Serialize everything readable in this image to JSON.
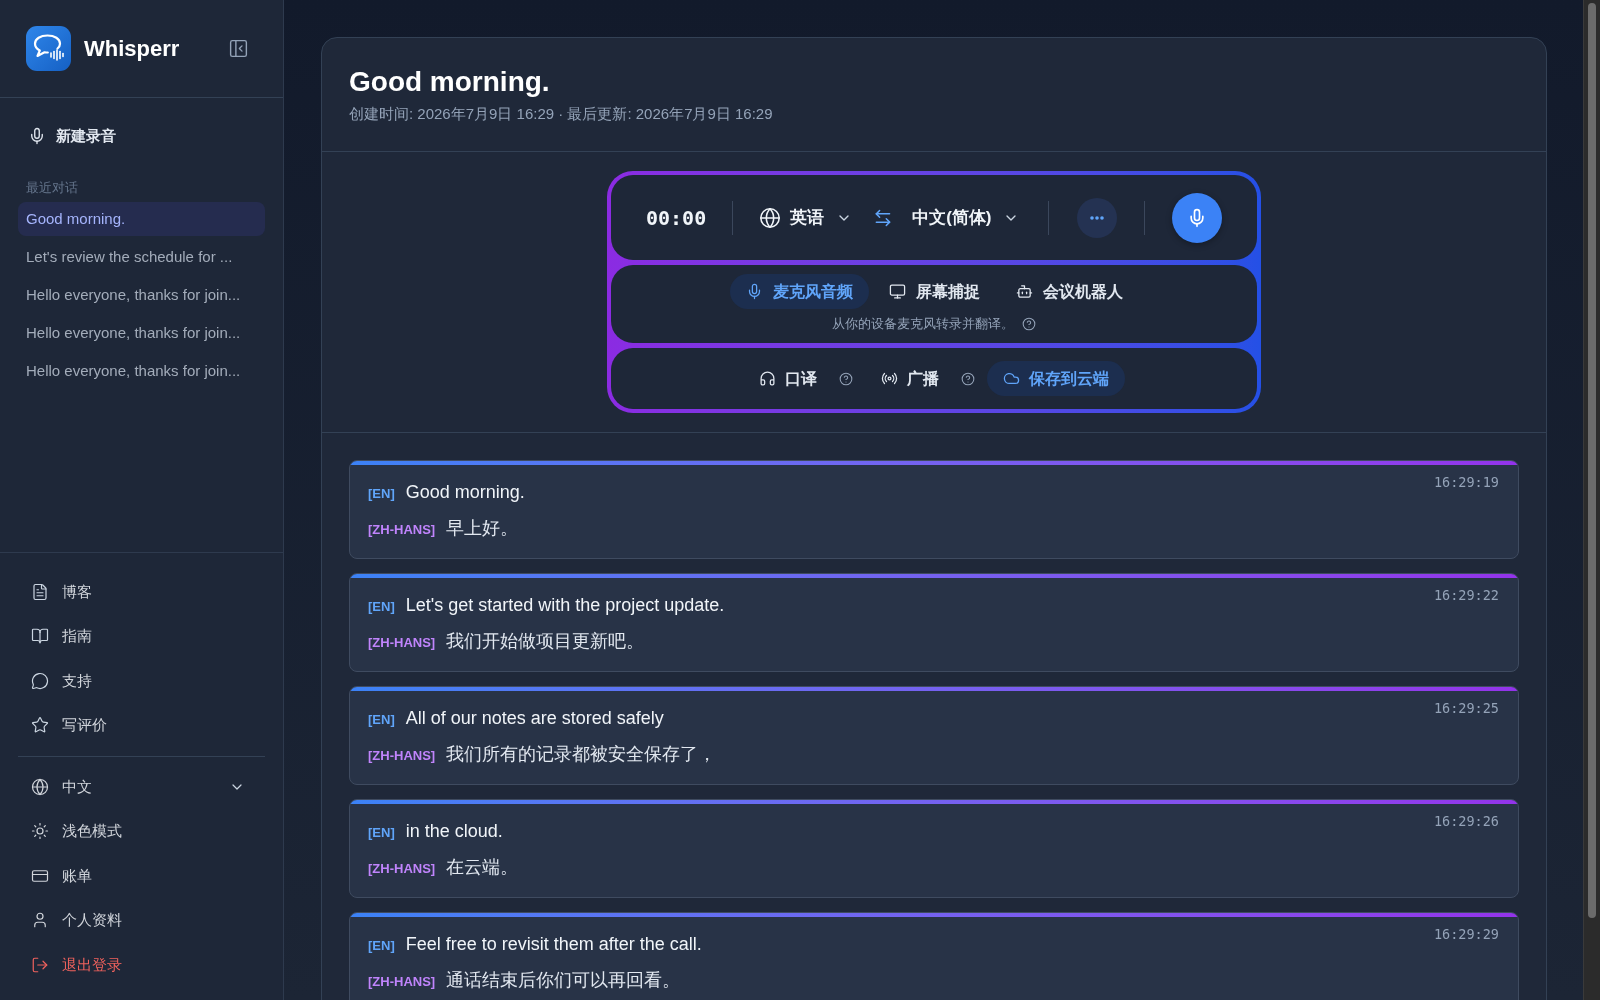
{
  "sidebar": {
    "app_name": "Whisperr",
    "new_recording": "新建录音",
    "recent_label": "最近对话",
    "recent": [
      {
        "title": "Good morning.",
        "selected": true
      },
      {
        "title": "Let's review the schedule for ...",
        "selected": false
      },
      {
        "title": "Hello everyone, thanks for join...",
        "selected": false
      },
      {
        "title": "Hello everyone, thanks for join...",
        "selected": false
      },
      {
        "title": "Hello everyone, thanks for join...",
        "selected": false
      }
    ],
    "links": [
      {
        "label": "博客"
      },
      {
        "label": "指南"
      },
      {
        "label": "支持"
      },
      {
        "label": "写评价"
      }
    ],
    "settings": [
      {
        "label": "中文",
        "kind": "dropdown"
      },
      {
        "label": "浅色模式",
        "kind": "link"
      },
      {
        "label": "账单",
        "kind": "link"
      },
      {
        "label": "个人资料",
        "kind": "link"
      },
      {
        "label": "退出登录",
        "kind": "danger"
      }
    ]
  },
  "conversation": {
    "title": "Good morning.",
    "meta": "创建时间: 2026年7月9日 16:29 · 最后更新: 2026年7月9日 16:29"
  },
  "recorder": {
    "timer": "00:00",
    "source_language": "英语",
    "target_language": "中文(简体)",
    "sources": [
      {
        "label": "麦克风音频",
        "selected": true
      },
      {
        "label": "屏幕捕捉",
        "selected": false
      },
      {
        "label": "会议机器人",
        "selected": false
      }
    ],
    "source_hint": "从你的设备麦克风转录并翻译。",
    "options": [
      {
        "label": "口译",
        "on": false,
        "help": true
      },
      {
        "label": "广播",
        "on": false,
        "help": true
      },
      {
        "label": "保存到云端",
        "on": true,
        "help": false
      }
    ]
  },
  "transcript": [
    {
      "time": "16:29:19",
      "lines": [
        {
          "kind": "original",
          "tag": "[EN]",
          "text": "Good morning."
        },
        {
          "kind": "translation",
          "tag": "[ZH-HANS]",
          "text": "早上好。"
        }
      ]
    },
    {
      "time": "16:29:22",
      "lines": [
        {
          "kind": "original",
          "tag": "[EN]",
          "text": "Let's get started with the project update."
        },
        {
          "kind": "translation",
          "tag": "[ZH-HANS]",
          "text": "我们开始做项目更新吧。"
        }
      ]
    },
    {
      "time": "16:29:25",
      "lines": [
        {
          "kind": "original",
          "tag": "[EN]",
          "text": "All of our notes are stored safely"
        },
        {
          "kind": "translation",
          "tag": "[ZH-HANS]",
          "text": "我们所有的记录都被安全保存了，"
        }
      ]
    },
    {
      "time": "16:29:26",
      "lines": [
        {
          "kind": "original",
          "tag": "[EN]",
          "text": "in the cloud."
        },
        {
          "kind": "translation",
          "tag": "[ZH-HANS]",
          "text": "在云端。"
        }
      ]
    },
    {
      "time": "16:29:29",
      "lines": [
        {
          "kind": "original",
          "tag": "[EN]",
          "text": "Feel free to revisit them after the call."
        },
        {
          "kind": "translation",
          "tag": "[ZH-HANS]",
          "text": "通话结束后你们可以再回看。"
        }
      ]
    }
  ]
}
